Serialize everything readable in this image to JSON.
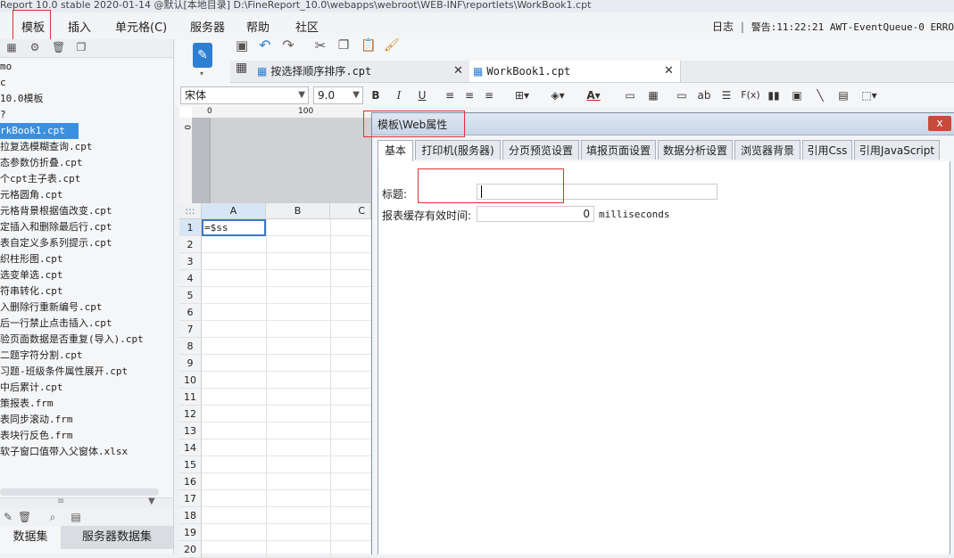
{
  "window": {
    "title": "Report 10.0 stable 2020-01-14 @默认[本地目录]    D:\\FineReport_10.0\\webapps\\webroot\\WEB-INF\\reportlets\\WorkBook1.cpt"
  },
  "menu": {
    "items": [
      "模板",
      "插入",
      "单元格(C)",
      "服务器",
      "帮助",
      "社区"
    ],
    "log_label": "日志",
    "warning_text": "警告:11:22:21 AWT-EventQueue-0 ERRO"
  },
  "file_panel": {
    "items": [
      "mo",
      "c",
      "10.0模板",
      "?",
      "rkBook1.cpt",
      "拉复选模糊查询.cpt",
      "态参数仿折叠.cpt",
      "个cpt主子表.cpt",
      "元格圆角.cpt",
      "元格背景根据值改变.cpt",
      "定插入和删除最后行.cpt",
      "表自定义多系列提示.cpt",
      "织柱形图.cpt",
      "选变单选.cpt",
      "符串转化.cpt",
      "入删除行重新编号.cpt",
      "后一行禁止点击插入.cpt",
      "验页面数据是否重复(导入).cpt",
      "二题字符分割.cpt",
      "习题-班级条件属性展开.cpt",
      "中后累计.cpt",
      "策报表.frm",
      "表同步滚动.frm",
      "表块行反色.frm",
      "软子窗口值带入父窗体.xlsx"
    ],
    "selected_index": 4,
    "tabs": [
      "数据集",
      "服务器数据集"
    ]
  },
  "doc_tabs": [
    {
      "label": "按选择顺序排序.cpt"
    },
    {
      "label": "WorkBook1.cpt"
    }
  ],
  "format_bar": {
    "font": "宋体",
    "size": "9.0",
    "bold": "B",
    "italic": "I",
    "underline": "U",
    "ab": "ab",
    "fx": "F(x)"
  },
  "sheet": {
    "ruler": {
      "zero": "0",
      "hundred": "100"
    },
    "corner": ":::",
    "columns": [
      "A",
      "B",
      "C"
    ],
    "rows": [
      "1",
      "2",
      "3",
      "4",
      "5",
      "6",
      "7",
      "8",
      "9",
      "10",
      "11",
      "12",
      "13",
      "14",
      "15",
      "16",
      "17",
      "18",
      "19",
      "20"
    ],
    "cell_a1": "=$ss"
  },
  "dialog": {
    "title": "模板\\Web属性",
    "close": "x",
    "tabs": [
      "基本",
      "打印机(服务器)",
      "分页预览设置",
      "填报页面设置",
      "数据分析设置",
      "浏览器背景",
      "引用Css",
      "引用JavaScript"
    ],
    "active_tab": 0,
    "fields": {
      "title_label": "标题:",
      "title_value": "",
      "cache_label": "报表缓存有效时间:",
      "cache_value": "0",
      "cache_unit": "milliseconds"
    }
  },
  "colors": {
    "selection": "#3a8fe0",
    "highlight_box": "#e03030",
    "dialog_close": "#c94a3b"
  }
}
